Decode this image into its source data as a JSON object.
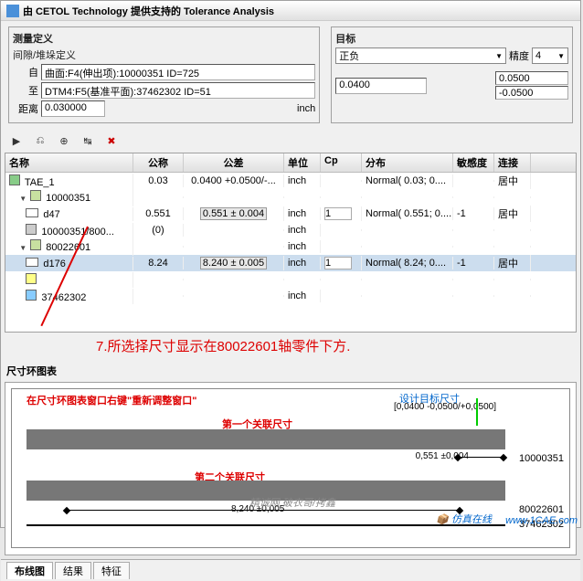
{
  "title": "由  CETOL  Technology  提供支持的  Tolerance  Analysis",
  "section1": "测量定义",
  "section2": "间隙/堆垛定义",
  "from_label": "自",
  "from_value": "曲面:F4(伸出项):10000351 ID=725",
  "to_label": "至",
  "to_value": "DTM4:F5(基准平面):37462302 ID=51",
  "dist_label": "距离",
  "dist_value": "0.030000",
  "unit_right": "inch",
  "target_label": "目标",
  "target_dd": "正负",
  "precision_label": "精度",
  "precision_value": "4",
  "target_center": "0.0400",
  "target_upper": "0.0500",
  "target_lower": "-0.0500",
  "cols": {
    "name": "名称",
    "nom": "公称",
    "tol": "公差",
    "unit": "单位",
    "cp": "Cp",
    "dist": "分布",
    "sens": "敏感度",
    "conn": "连接"
  },
  "rows": [
    {
      "ind": 0,
      "icon": "tae",
      "name": "TAE_1",
      "nom": "0.03",
      "tol": "0.0400 +0.0500/-...",
      "unit": "inch",
      "cp": "",
      "dist": "Normal( 0.03; 0....",
      "sens": "",
      "conn": "居中"
    },
    {
      "ind": 1,
      "icon": "tri",
      "name": "10000351",
      "nom": "",
      "tol": "",
      "unit": "",
      "cp": "",
      "dist": "",
      "sens": "",
      "conn": ""
    },
    {
      "ind": 2,
      "icon": "dim",
      "name": "d47",
      "nom": "0.551",
      "tol": "0.551 ± 0.004",
      "btn": true,
      "unit": "inch",
      "cp": "1",
      "cpinput": true,
      "dist": "Normal( 0.551; 0....",
      "sens": "-1",
      "conn": "居中"
    },
    {
      "ind": 2,
      "icon": "mat",
      "name": "10000351/800...",
      "nom": "(0)",
      "tol": "",
      "unit": "inch",
      "cp": "",
      "dist": "",
      "sens": "",
      "conn": ""
    },
    {
      "ind": 1,
      "icon": "tri",
      "name": "80022601",
      "nom": "",
      "tol": "",
      "unit": "inch",
      "cp": "",
      "dist": "",
      "sens": "",
      "conn": ""
    },
    {
      "ind": 2,
      "icon": "dim",
      "name": "d176",
      "nom": "8.24",
      "tol": "8.240 ± 0.005",
      "btn": true,
      "unit": "inch",
      "cp": "1",
      "cpinput": true,
      "dist": "Normal( 8.24; 0....",
      "sens": "-1",
      "conn": "居中",
      "sel": true
    },
    {
      "ind": 2,
      "icon": "box",
      "name": "",
      "nom": "",
      "tol": "",
      "unit": "",
      "cp": "",
      "dist": "",
      "sens": "",
      "conn": ""
    },
    {
      "ind": 2,
      "icon": "ref",
      "name": "37462302",
      "nom": "",
      "tol": "",
      "unit": "inch",
      "cp": "",
      "dist": "",
      "sens": "",
      "conn": ""
    }
  ],
  "annotation": "7.所选择尺寸显示在80022601轴零件下方.",
  "chart_title": "尺寸环图表",
  "chart": {
    "note_window": "在尺寸环图表窗口右键\"重新调整窗口\"",
    "label_design": "设计目标尺寸",
    "label_first": "第一个关联尺寸",
    "label_second": "第二个关联尺寸",
    "design_range": "[0,0400 -0,0500/+0,0500]",
    "dim1": "0,551 ±0,004",
    "dim2": "8,240 ±0,005",
    "right1": "10000351",
    "right2": "80022601",
    "right3": "37462302"
  },
  "tabs": [
    "布线图",
    "结果",
    "特征"
  ],
  "watermark_center": "精诚网  破衣哥/拷鑫",
  "watermark_sim": "仿真在线",
  "watermark_url": "www.1CAE.com",
  "chart_data": {
    "type": "bar",
    "title": "尺寸环图表",
    "series": [
      {
        "name": "10000351",
        "start": 8.24,
        "end": 8.791,
        "label": "0,551 ±0,004"
      },
      {
        "name": "80022601",
        "start": 0.0,
        "end": 8.24,
        "label": "8,240 ±0,005"
      },
      {
        "name": "37462302",
        "start": 0.0,
        "end": 8.791
      }
    ],
    "target": {
      "value": 0.04,
      "tol": [
        -0.05,
        0.05
      ]
    },
    "xlim": [
      0,
      8.8
    ]
  }
}
